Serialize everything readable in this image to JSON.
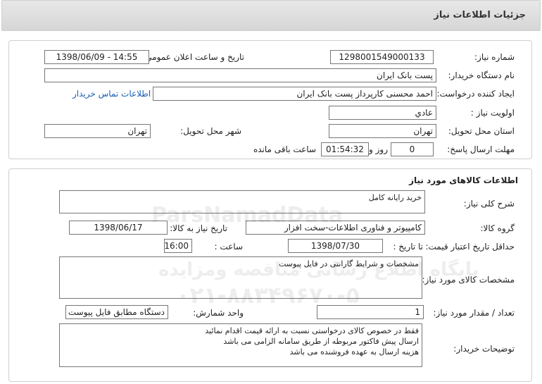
{
  "header": {
    "title": "جزئیات اطلاعات نیاز"
  },
  "need_info": {
    "need_number_label": "شماره نیاز:",
    "need_number": "1298001549000133",
    "announce_datetime_label": "تاریخ و ساعت اعلان عمومی:",
    "announce_datetime": "1398/06/09 - 14:55",
    "buyer_org_label": "نام دستگاه خریدار:",
    "buyer_org": "پست بانک ایران",
    "creator_label": "ایجاد کننده درخواست:",
    "creator": "احمد  محسنی کارپرداز پست بانک ایران",
    "contact_link": "اطلاعات تماس خریدار",
    "priority_label": "اولویت نیاز :",
    "priority": "عادي",
    "province_label": "استان محل تحویل:",
    "province": "تهران",
    "city_label": "شهر محل تحویل:",
    "city": "تهران",
    "deadline_label": "مهلت ارسال پاسخ:",
    "deadline_days": "0",
    "days_label": "روز و",
    "deadline_time": "01:54:32",
    "remaining_label": "ساعت باقی مانده"
  },
  "goods": {
    "section_title": "اطلاعات کالاهای مورد نیاز",
    "summary_label": "شرح کلی نیاز:",
    "summary": "خرید رایانه کامل",
    "group_label": "گروه کالا:",
    "group": "کامپیوتر و فناوری اطلاعات-سخت افزار",
    "need_date_label": "تاریخ نیاز به کالا:",
    "need_date": "1398/06/17",
    "price_validity_label": "حداقل تاریخ اعتبار قیمت:",
    "until_date_label": "تا تاریخ :",
    "until_date": "1398/07/30",
    "time_label": "ساعت :",
    "time": "16:00",
    "specs_label": "مشخصات کالای مورد نیاز:",
    "specs": "مشخصات و شرایط گارانتی در فایل پیوست",
    "qty_label": "تعداد / مقدار مورد نیاز:",
    "qty": "1",
    "unit_label": "واحد شمارش:",
    "unit": "دستگاه مطابق فایل پیوست",
    "buyer_notes_label": "توضیحات خریدار:",
    "buyer_notes": [
      "فقط در خصوص کالای درخواستی نسبت به ارائه قیمت اقدام نمائید",
      "ارسال پیش فاکتور مربوطه از طریق سامانه الزامی می باشد",
      "هزینه ارسال به عهده فروشنده می باشد"
    ]
  },
  "watermark": {
    "brand": "ParsNamadData",
    "tagline": "پایگاه اطلاع رسانی مناقصه ومزایده",
    "phone": "۰۲۱-۸۸۳۴۹۶۷۰-۵"
  }
}
